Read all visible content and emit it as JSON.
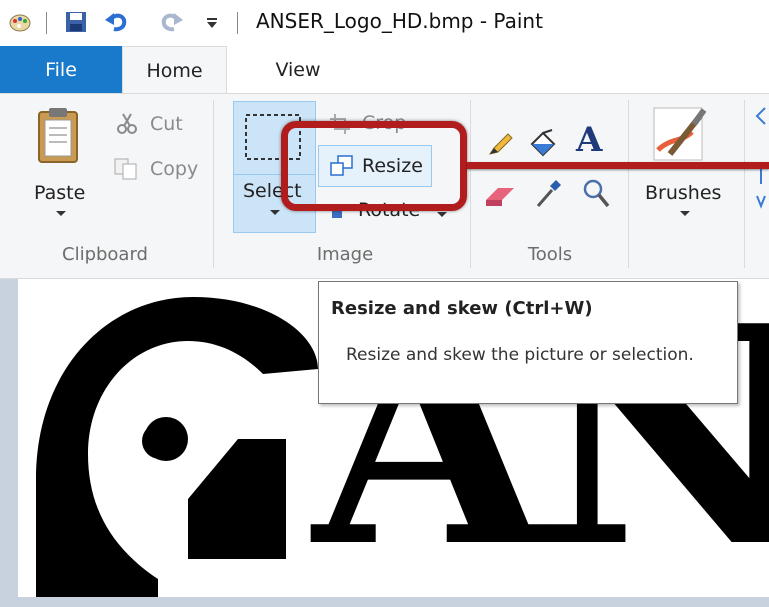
{
  "window": {
    "title": "ANSER_Logo_HD.bmp - Paint"
  },
  "quick_access": {
    "icons": [
      "paint-app-icon",
      "save-icon",
      "undo-icon",
      "redo-icon",
      "customize-dropdown-icon"
    ]
  },
  "tabs": [
    {
      "label": "File",
      "active": false
    },
    {
      "label": "Home",
      "active": true
    },
    {
      "label": "View",
      "active": false
    }
  ],
  "ribbon": {
    "clipboard": {
      "group_label": "Clipboard",
      "paste_label": "Paste",
      "cut_label": "Cut",
      "copy_label": "Copy"
    },
    "image": {
      "group_label": "Image",
      "select_label": "Select",
      "crop_label": "Crop",
      "resize_label": "Resize",
      "rotate_label": "Rotate"
    },
    "tools": {
      "group_label": "Tools",
      "icons": [
        "pencil-icon",
        "fill-bucket-icon",
        "text-icon",
        "eraser-icon",
        "color-picker-icon",
        "magnifier-icon"
      ]
    },
    "brushes_label": "Brushes"
  },
  "tooltip": {
    "title": "Resize and skew (Ctrl+W)",
    "body": "Resize and skew the picture or selection."
  },
  "canvas": {
    "logo_text": "AN"
  },
  "colors": {
    "file_tab": "#1979ca",
    "ribbon_bg": "#f5f6f7",
    "selected_bg": "#cce4f7",
    "annotation_red": "#b11d1d",
    "canvas_bg": "#c8d1de"
  }
}
